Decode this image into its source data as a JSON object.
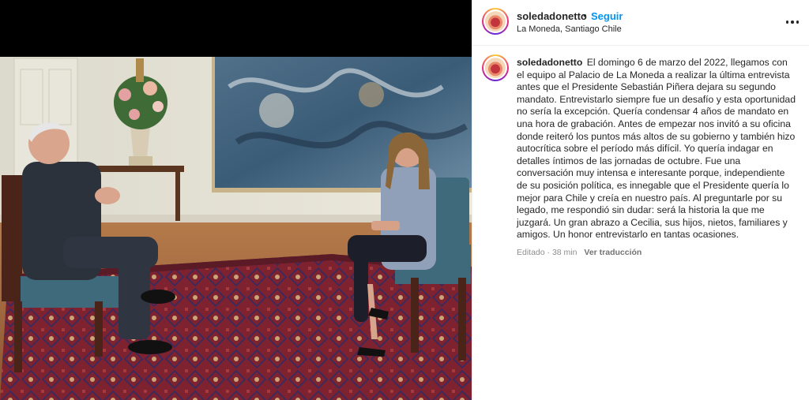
{
  "post": {
    "username": "soledadonetto",
    "separator": "•",
    "follow_label": "Seguir",
    "location": "La Moneda, Santiago Chile",
    "caption": "El domingo 6 de marzo del 2022, llegamos con el equipo al Palacio de La Moneda a realizar la última entrevista antes que el Presidente Sebastián Piñera dejara su segundo mandato. Entrevistarlo siempre fue un desafío y esta oportunidad no sería la excepción. Quería condensar 4 años de mandato en una hora de grabación. Antes de empezar nos invitó a su oficina donde reiteró los puntos más altos de su gobierno y también hizo autocrítica sobre el período más difícil. Yo quería indagar en detalles íntimos de las jornadas de octubre. Fue una conversación muy intensa e interesante porque, independiente de su posición política, es innegable que el Presidente quería lo mejor para Chile y creía en nuestro país. Al preguntarle por su legado, me respondió sin dudar: será la historia la que me juzgará. Un gran abrazo a Cecilia, sus hijos, nietos, familiares y amigos. Un honor entrevistarlo en tantas ocasiones.",
    "edited_meta": "Editado · 38 min",
    "translate_label": "Ver traducción"
  },
  "icons": {
    "more": "more-horizontal-icon"
  },
  "colors": {
    "follow": "#0095f6",
    "text": "#262626",
    "muted": "#8e8e8e"
  }
}
